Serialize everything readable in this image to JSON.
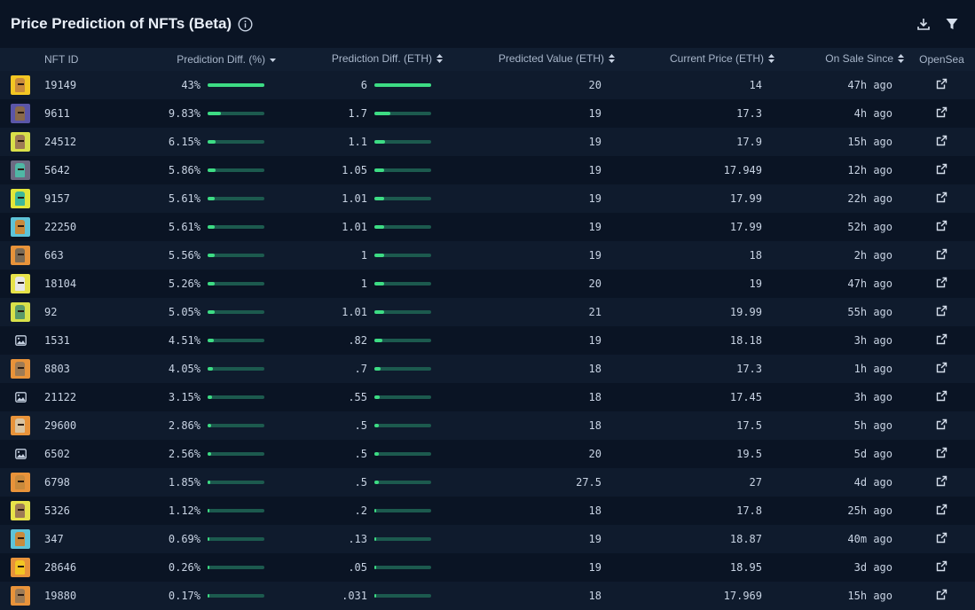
{
  "title": "Price Prediction of NFTs (Beta)",
  "columns": {
    "nft_id": "NFT ID",
    "pred_diff_pct": "Prediction Diff. (%)",
    "pred_diff_eth": "Prediction Diff. (ETH)",
    "predicted_value": "Predicted Value (ETH)",
    "current_price": "Current Price (ETH)",
    "on_sale_since": "On Sale Since",
    "opensea": "OpenSea"
  },
  "colors": {
    "accent": "#3ddc84",
    "bar_track": "#1c5a4e"
  },
  "rows": [
    {
      "id": "19149",
      "pct": "43%",
      "pct_ratio": 1.0,
      "eth": "6",
      "eth_ratio": 1.0,
      "pred": "20",
      "cur": "14",
      "since": "47h ago",
      "thumb": "#f3c623",
      "face": "#c98a3c"
    },
    {
      "id": "9611",
      "pct": "9.83%",
      "pct_ratio": 0.2286,
      "eth": "1.7",
      "eth_ratio": 0.2833,
      "pred": "19",
      "cur": "17.3",
      "since": "4h ago",
      "thumb": "#5b56a8",
      "face": "#8a6a4a"
    },
    {
      "id": "24512",
      "pct": "6.15%",
      "pct_ratio": 0.143,
      "eth": "1.1",
      "eth_ratio": 0.1833,
      "pred": "19",
      "cur": "17.9",
      "since": "15h ago",
      "thumb": "#d9e04a",
      "face": "#9e7b55"
    },
    {
      "id": "5642",
      "pct": "5.86%",
      "pct_ratio": 0.1363,
      "eth": "1.05",
      "eth_ratio": 0.175,
      "pred": "19",
      "cur": "17.949",
      "since": "12h ago",
      "thumb": "#6d6a82",
      "face": "#4fb7a5"
    },
    {
      "id": "9157",
      "pct": "5.61%",
      "pct_ratio": 0.1305,
      "eth": "1.01",
      "eth_ratio": 0.1683,
      "pred": "19",
      "cur": "17.99",
      "since": "22h ago",
      "thumb": "#e3e63a",
      "face": "#3fb89a"
    },
    {
      "id": "22250",
      "pct": "5.61%",
      "pct_ratio": 0.1305,
      "eth": "1.01",
      "eth_ratio": 0.1683,
      "pred": "19",
      "cur": "17.99",
      "since": "52h ago",
      "thumb": "#5ec3d8",
      "face": "#c98a3c"
    },
    {
      "id": "663",
      "pct": "5.56%",
      "pct_ratio": 0.1293,
      "eth": "1",
      "eth_ratio": 0.1667,
      "pred": "19",
      "cur": "18",
      "since": "2h ago",
      "thumb": "#e8933a",
      "face": "#7b6a55"
    },
    {
      "id": "18104",
      "pct": "5.26%",
      "pct_ratio": 0.1223,
      "eth": "1",
      "eth_ratio": 0.1667,
      "pred": "20",
      "cur": "19",
      "since": "47h ago",
      "thumb": "#e7e24a",
      "face": "#e6e6e6"
    },
    {
      "id": "92",
      "pct": "5.05%",
      "pct_ratio": 0.1174,
      "eth": "1.01",
      "eth_ratio": 0.1683,
      "pred": "21",
      "cur": "19.99",
      "since": "55h ago",
      "thumb": "#d8e14a",
      "face": "#5a9a6a"
    },
    {
      "id": "1531",
      "pct": "4.51%",
      "pct_ratio": 0.1049,
      "eth": ".82",
      "eth_ratio": 0.1367,
      "pred": "19",
      "cur": "18.18",
      "since": "3h ago",
      "thumb": "",
      "face": ""
    },
    {
      "id": "8803",
      "pct": "4.05%",
      "pct_ratio": 0.0942,
      "eth": ".7",
      "eth_ratio": 0.1167,
      "pred": "18",
      "cur": "17.3",
      "since": "1h ago",
      "thumb": "#e8933a",
      "face": "#9e7b55"
    },
    {
      "id": "21122",
      "pct": "3.15%",
      "pct_ratio": 0.0733,
      "eth": ".55",
      "eth_ratio": 0.0917,
      "pred": "18",
      "cur": "17.45",
      "since": "3h ago",
      "thumb": "",
      "face": ""
    },
    {
      "id": "29600",
      "pct": "2.86%",
      "pct_ratio": 0.0665,
      "eth": ".5",
      "eth_ratio": 0.0833,
      "pred": "18",
      "cur": "17.5",
      "since": "5h ago",
      "thumb": "#e8933a",
      "face": "#d9c3a0"
    },
    {
      "id": "6502",
      "pct": "2.56%",
      "pct_ratio": 0.0595,
      "eth": ".5",
      "eth_ratio": 0.0833,
      "pred": "20",
      "cur": "19.5",
      "since": "5d ago",
      "thumb": "",
      "face": ""
    },
    {
      "id": "6798",
      "pct": "1.85%",
      "pct_ratio": 0.043,
      "eth": ".5",
      "eth_ratio": 0.0833,
      "pred": "27.5",
      "cur": "27",
      "since": "4d ago",
      "thumb": "#e8933a",
      "face": "#c98a3c"
    },
    {
      "id": "5326",
      "pct": "1.12%",
      "pct_ratio": 0.026,
      "eth": ".2",
      "eth_ratio": 0.0333,
      "pred": "18",
      "cur": "17.8",
      "since": "25h ago",
      "thumb": "#e7e24a",
      "face": "#9e7b55"
    },
    {
      "id": "347",
      "pct": "0.69%",
      "pct_ratio": 0.016,
      "eth": ".13",
      "eth_ratio": 0.0217,
      "pred": "19",
      "cur": "18.87",
      "since": "40m ago",
      "thumb": "#5ec3d8",
      "face": "#c98a3c"
    },
    {
      "id": "28646",
      "pct": "0.26%",
      "pct_ratio": 0.006,
      "eth": ".05",
      "eth_ratio": 0.0083,
      "pred": "19",
      "cur": "18.95",
      "since": "3d ago",
      "thumb": "#e8933a",
      "face": "#f3c623"
    },
    {
      "id": "19880",
      "pct": "0.17%",
      "pct_ratio": 0.004,
      "eth": ".031",
      "eth_ratio": 0.0052,
      "pred": "18",
      "cur": "17.969",
      "since": "15h ago",
      "thumb": "#e8933a",
      "face": "#9e7b55"
    }
  ]
}
